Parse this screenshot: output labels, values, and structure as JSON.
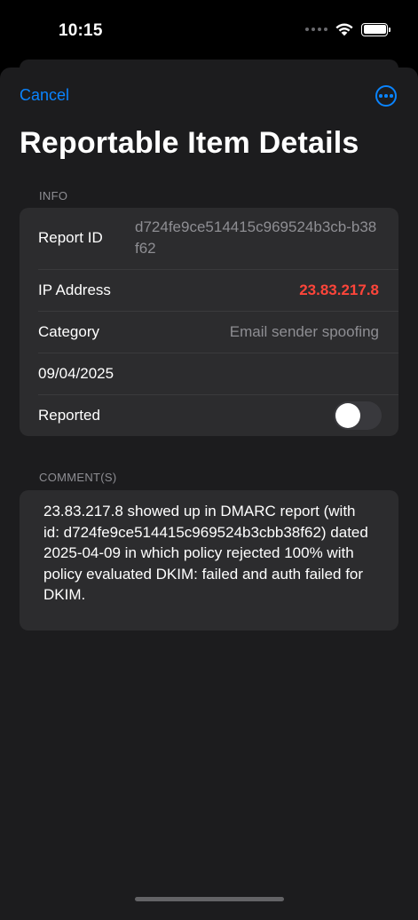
{
  "status_bar": {
    "time": "10:15"
  },
  "nav": {
    "cancel_label": "Cancel",
    "more_icon": "ellipsis-circle-icon"
  },
  "title": "Reportable Item Details",
  "info": {
    "header": "INFO",
    "report_id_label": "Report ID",
    "report_id_value": "d724fe9ce514415c969524b3cb-b38f62",
    "ip_label": "IP Address",
    "ip_value": "23.83.217.8",
    "category_label": "Category",
    "category_value": "Email sender spoofing",
    "date_value": "09/04/2025",
    "reported_label": "Reported",
    "reported_on": false
  },
  "comments": {
    "header": "COMMENT(S)",
    "text": "23.83.217.8 showed up in DMARC report (with id: d724fe9ce514415c969524b3cbb38f62) dated 2025-04-09 in which policy rejected 100% with policy evaluated DKIM: failed  and auth failed for DKIM."
  },
  "colors": {
    "accent": "#0a84ff",
    "ip_highlight": "#ff453a",
    "background": "#1c1c1e",
    "group_background": "#2c2c2e"
  }
}
